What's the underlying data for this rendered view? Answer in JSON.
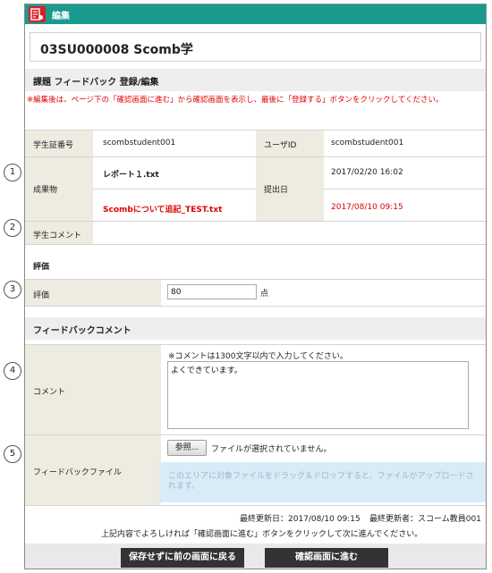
{
  "header": {
    "title": "編集",
    "icon": "edit-document-icon"
  },
  "student_name": "03SU000008 Scomb学",
  "section": {
    "title": "課題 フィードバック 登録/編集",
    "notice": "※編集後は、ページ下の「確認画面に進む」から確認画面を表示し、最後に「登録する」ボタンをクリックしてください。"
  },
  "student_info": {
    "id_label": "学生証番号",
    "id_value": "scombstudent001",
    "user_label": "ユーザID",
    "user_value": "scombstudent001"
  },
  "deliverables": {
    "label": "成果物",
    "date_label": "提出日",
    "files": [
      {
        "name": "レポート１.txt",
        "date": "2017/02/20 16:02"
      },
      {
        "name": "Scombについて追記_TEST.txt",
        "date": "2017/08/10 09:15"
      }
    ]
  },
  "student_comment": {
    "label": "学生コメント",
    "value": ""
  },
  "evaluation": {
    "heading": "評価",
    "label": "評価",
    "value": "80",
    "unit": "点"
  },
  "feedback_comment": {
    "heading": "フィードバックコメント",
    "label": "コメント",
    "note": "※コメントは1300文字以内で入力してください。",
    "value": "よくできています。"
  },
  "feedback_file": {
    "label": "フィードバックファイル",
    "browse_label": "参照...",
    "status": "ファイルが選択されていません。",
    "dropzone": "このエリアに対象ファイルをドラッグ＆ドロップすると、ファイルがアップロードされます。"
  },
  "footer": {
    "updated": "最終更新日：2017/08/10 09:15",
    "updater": "最終更新者：スコーム教員001",
    "instruction": "上記内容でよろしければ「確認画面に進む」ボタンをクリックして次に進んでください。",
    "back_label": "保存せずに前の画面に戻る",
    "confirm_label": "確認画面に進む"
  },
  "markers": [
    "1",
    "2",
    "3",
    "4",
    "5"
  ],
  "colors": {
    "header": "#1a9a8f",
    "badge": "#d81f26",
    "warn": "#e00000",
    "label_bg": "#eeece0",
    "dropzone": "#d8ecf8"
  }
}
